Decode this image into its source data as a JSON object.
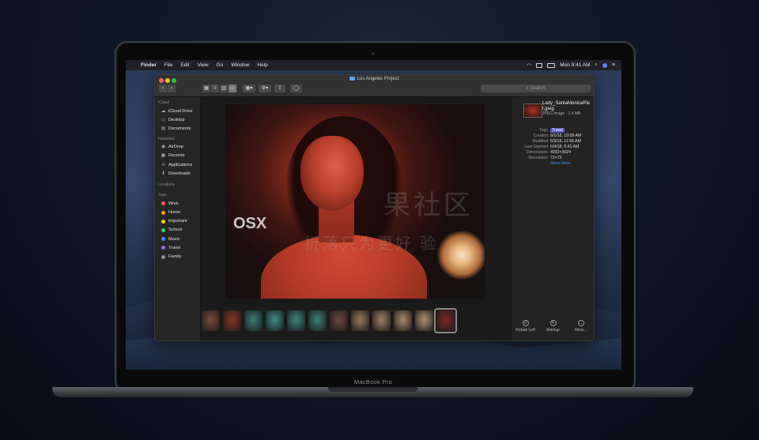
{
  "device": {
    "label": "MacBook Pro"
  },
  "menubar": {
    "apple": "",
    "app": "Finder",
    "menus": [
      "File",
      "Edit",
      "View",
      "Go",
      "Window",
      "Help"
    ],
    "clock": "Mon 9:41 AM"
  },
  "window": {
    "title": "Los Angeles Project",
    "search_placeholder": "Search"
  },
  "sidebar": {
    "sections": [
      {
        "heading": "iCloud",
        "items": [
          {
            "label": "iCloud Drive",
            "icon": "cloud-icon"
          },
          {
            "label": "Desktop",
            "icon": "desktop-icon"
          },
          {
            "label": "Documents",
            "icon": "document-icon"
          }
        ]
      },
      {
        "heading": "Favorites",
        "items": [
          {
            "label": "AirDrop",
            "icon": "airdrop-icon"
          },
          {
            "label": "Recents",
            "icon": "recents-icon"
          },
          {
            "label": "Applications",
            "icon": "applications-icon"
          },
          {
            "label": "Downloads",
            "icon": "download-icon"
          }
        ]
      },
      {
        "heading": "Locations",
        "items": []
      },
      {
        "heading": "Tags",
        "items": [
          {
            "label": "Work",
            "color": "#ff5f57"
          },
          {
            "label": "Home",
            "color": "#ff9f0a"
          },
          {
            "label": "Important",
            "color": "#ffd60a"
          },
          {
            "label": "School",
            "color": "#32d74b"
          },
          {
            "label": "Music",
            "color": "#3a8ef6"
          },
          {
            "label": "Travel",
            "color": "#9b6cf7"
          },
          {
            "label": "Family",
            "color": "#8e8e93"
          }
        ]
      }
    ]
  },
  "gallery": {
    "watermark_latin": "OSX",
    "watermark_cjk_1": "果社区",
    "watermark_cjk_2": "折落只为更好 验",
    "thumbnails": [
      "#7a4a3a",
      "#8a3424",
      "#3a7a78",
      "#3e8a86",
      "#3b8480",
      "#3a7e7a",
      "#6a4a3a",
      "#9a7a5a",
      "#a08060",
      "#a88a6a",
      "#b09070",
      "#7a2a1e"
    ],
    "selected_index": 11
  },
  "inspector": {
    "filename": "Lady_SantaMonicaPier.jpeg",
    "kind": "JPEG image - 1.4 MB",
    "meta": [
      {
        "key": "Tags",
        "value": "Travel",
        "pill": true
      },
      {
        "key": "Created",
        "value": "6/1/18, 10:09 AM"
      },
      {
        "key": "Modified",
        "value": "6/3/18, 11:56 AM"
      },
      {
        "key": "Last Opened",
        "value": "6/4/18, 9:41 AM"
      },
      {
        "key": "Dimensions",
        "value": "4032×3024"
      },
      {
        "key": "Resolution",
        "value": "72×72"
      }
    ],
    "show_more": "Show More",
    "actions": [
      {
        "label": "Rotate Left",
        "icon": "rotate-left-icon"
      },
      {
        "label": "Markup",
        "icon": "markup-icon"
      },
      {
        "label": "More...",
        "icon": "more-icon"
      }
    ]
  }
}
